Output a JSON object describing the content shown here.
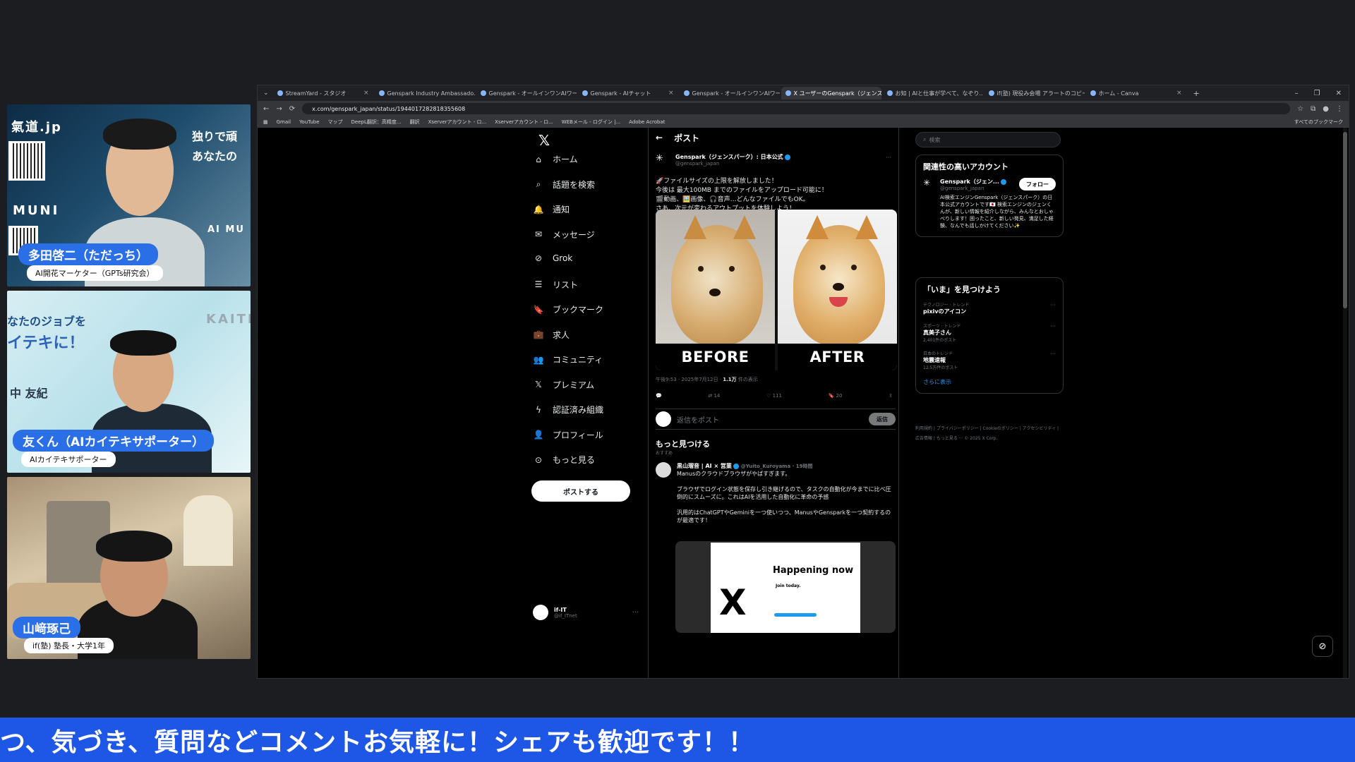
{
  "colors": {
    "accent": "#1d9bf0",
    "ticker": "#1e56e6",
    "name_tag": "#2b6fe6"
  },
  "participants": [
    {
      "name": "多田啓二（ただっち）",
      "role": "AI開花マーケター（GPTs研究会）",
      "bg_top": "氣道.jp",
      "bg_right1": "独りで頑",
      "bg_right2": "あなたの",
      "bg_mid": "MUNI",
      "bg_corner": "AI MU"
    },
    {
      "name": "友くん（AIカイテキサポーター）",
      "role": "AIカイテキサポーター",
      "bg_top": "なたのジョブを",
      "bg_mid": "イテキに！",
      "bg_right": "KAITE",
      "bg_name": "中 友紀"
    },
    {
      "name": "山﨑琢己",
      "role": "if(塾) 塾長・大学1年"
    }
  ],
  "browser": {
    "tabs": [
      {
        "label": "StreamYard - スタジオ",
        "active": false
      },
      {
        "label": "Genspark Industry Ambassado...",
        "active": false
      },
      {
        "label": "Genspark - オールインワンAIワーク...",
        "active": false
      },
      {
        "label": "Genspark - AIチャット",
        "active": false
      },
      {
        "label": "Genspark - オールインワンAIワーク...",
        "active": false
      },
      {
        "label": "X ユーザーのGenspark（ジェンスパ...",
        "active": true
      },
      {
        "label": "お知 | AIと仕事が学べて、なぞり...",
        "active": false
      },
      {
        "label": "if(塾) 現役み会場 アラートのコピー",
        "active": false
      },
      {
        "label": "ホーム - Canva",
        "active": false
      }
    ],
    "url": "x.com/genspark_japan/status/1944017282818355608",
    "bookmarks": [
      "Gmail",
      "YouTube",
      "マップ",
      "DeepL翻訳：高精度...",
      "翻訳",
      "Xserverアカウント - ロ...",
      "Xserverアカウント - ロ...",
      "WEBメール - ログイン |...",
      "Adobe Acrobat"
    ],
    "bookmarks_right": "すべてのブックマーク"
  },
  "x": {
    "nav": [
      "ホーム",
      "話題を検索",
      "通知",
      "メッセージ",
      "Grok",
      "リスト",
      "ブックマーク",
      "求人",
      "コミュニティ",
      "プレミアム",
      "認証済み組織",
      "プロフィール",
      "もっと見る"
    ],
    "post_button": "ポストする",
    "account": {
      "name": "if-IT",
      "handle": "@if_ITnet"
    },
    "header": "ポスト",
    "tweet": {
      "author": "Genspark（ジェンスパーク）: 日本公式",
      "handle": "@genspark_japan",
      "text": "🚀ファイルサイズの上限を解放しました！\n今後は 最大100MB までのファイルをアップロード可能に！\n🎬動画、🖼️画像、🎧音声…どんなファイルでもOK。\nさあ、次元が変わるアウトプットを体験しよう！",
      "before": "BEFORE",
      "after": "AFTER",
      "time": "午後9:53 · 2025年7月12日 · ",
      "views": "1.1万",
      "views_suffix": " 件の表示",
      "retweets": "14",
      "likes": "111",
      "bookmarks": "20"
    },
    "reply_placeholder": "返信をポスト",
    "reply_button": "返信",
    "more_heading": "もっと見つける",
    "more_sub": "おすすめ",
    "tweet2": {
      "author": "黒山瑠音 | AI × 営業",
      "handle": "@Yuito_Kuroyama · 19時間",
      "text": "Manusのクラウドブラウザがやばすぎます。\n\nブラウザでログイン状態を保存し引き継げるので、タスクの自動化が今までに比べ圧倒的にスムーズに。これはAIを活用した自動化に革命の予感\n\n汎用的はChatGPTやGeminiを一つ使いつつ、ManusやGensparkを一つ契約するのが最適です！",
      "happening": "Happening now",
      "join": "Join today."
    },
    "search_placeholder": "検索",
    "related_title": "関連性の高いアカウント",
    "related": {
      "name": "Genspark（ジェン...",
      "handle": "@genspark_japan",
      "follow": "フォロー",
      "bio": "AI検索エンジンGenspark（ジェンスパーク）の日本公式アカウントです🇯🇵 検索エンジンのジェンくんが、新しい情報を紹介しながら、みんなとおしゃべりします！困ったこと、新しい発見、満足した経験、なんでも話しかけてください✨"
    },
    "trends_title": "「いま」を見つけよう",
    "trends": [
      {
        "cat": "テクノロジー · トレンド",
        "title": "pixivのアイコン",
        "count": ""
      },
      {
        "cat": "スポーツ · トレンド",
        "title": "真美子さん",
        "count": "2,401件のポスト"
      },
      {
        "cat": "日本のトレンド",
        "title": "地震速報",
        "count": "12.5万件のポスト"
      }
    ],
    "show_more": "さらに表示",
    "footer": "利用規約 | プライバシーポリシー | Cookieのポリシー | アクセシビリティ | 広告情報 | もっと見る ··· © 2025 X Corp."
  },
  "ticker": "つ、気づき、質問などコメントお気軽に！シェアも歓迎です！！"
}
